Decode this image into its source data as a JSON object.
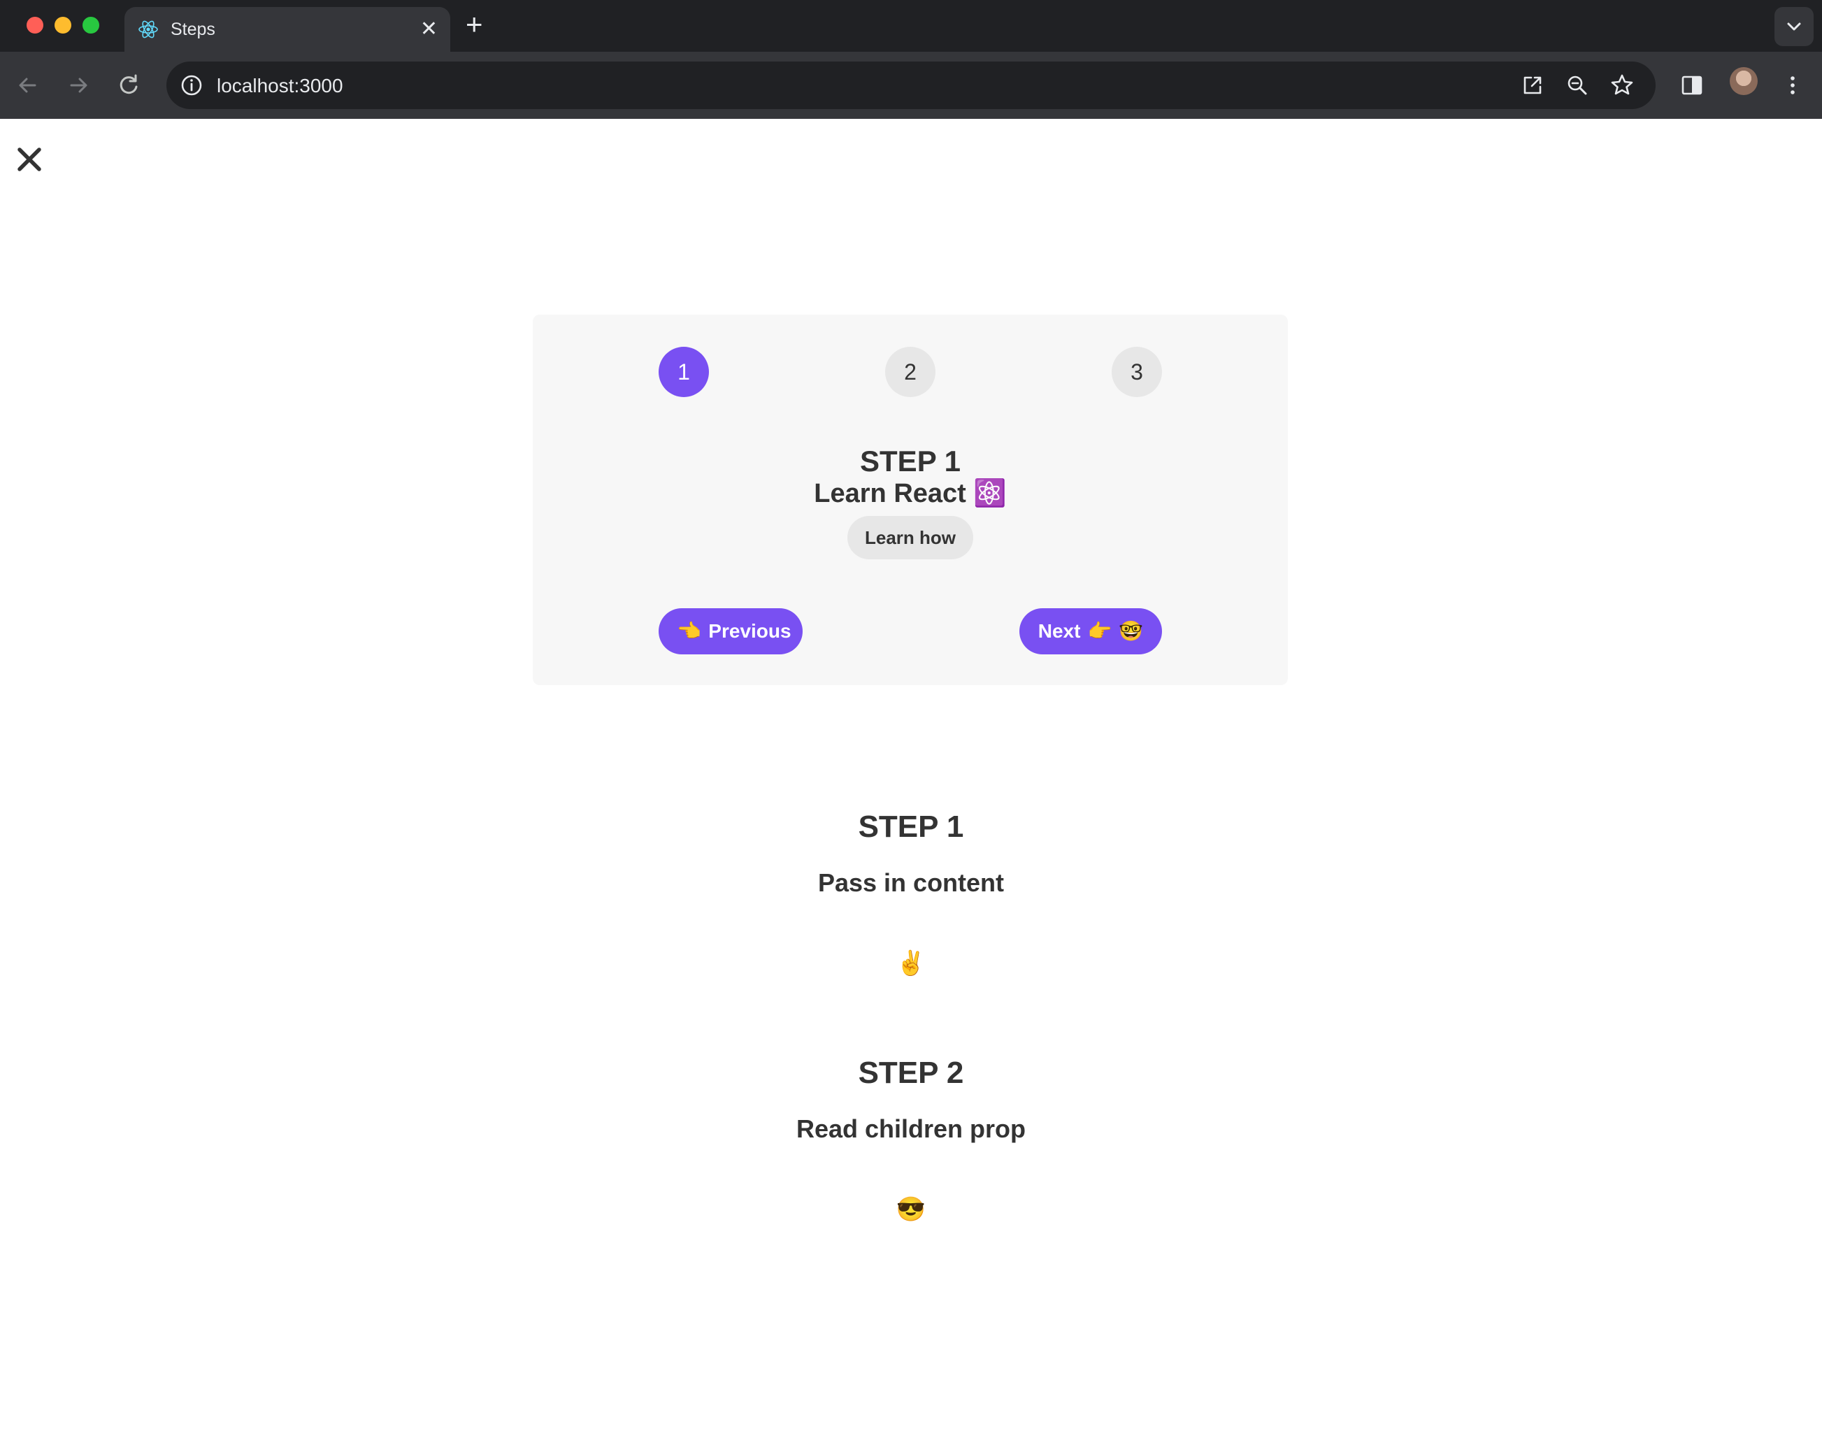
{
  "browser": {
    "tab_title": "Steps",
    "tab_close": "✕",
    "new_tab": "+",
    "url": "localhost:3000"
  },
  "steps": {
    "numbers": [
      "1",
      "2",
      "3"
    ],
    "active_step": 1,
    "title": "STEP 1",
    "content": "Learn React ⚛️",
    "learn_button": "Learn how",
    "previous": {
      "emoji": "👈",
      "label": "Previous"
    },
    "next": {
      "label": "Next",
      "emoji_1": "👉",
      "emoji_2": "🤓"
    }
  },
  "messages": [
    {
      "title": "STEP 1",
      "text": "Pass in content",
      "emoji": "✌️"
    },
    {
      "title": "STEP 2",
      "text": "Read children prop",
      "emoji": "😎"
    }
  ],
  "colors": {
    "accent": "#7950f2",
    "card_bg": "#f7f7f7",
    "inactive_bg": "#e7e7e7",
    "text": "#333333"
  }
}
